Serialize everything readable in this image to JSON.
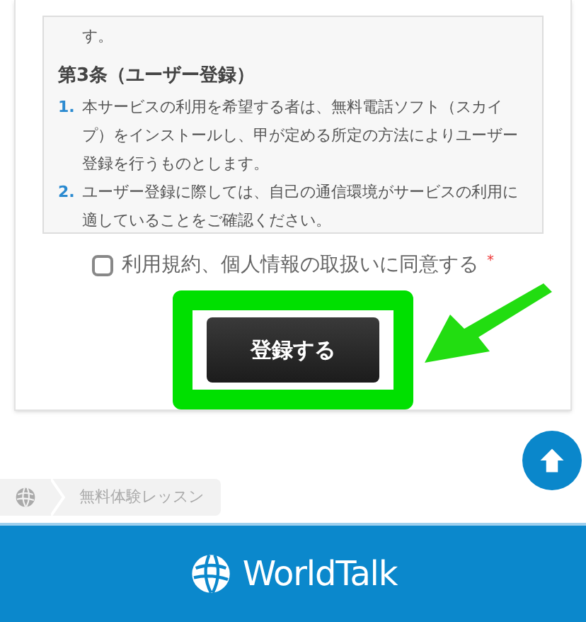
{
  "terms_box": {
    "lead_line": "す。",
    "article_heading": "第3条（ユーザー登録）",
    "items": [
      {
        "number": "1.",
        "text": "本サービスの利用を希望する者は、無料電話ソフト（スカイプ）をインストールし、甲が定める所定の方法によりユーザー登録を行うものとします。"
      },
      {
        "number": "2.",
        "text": "ユーザー登録に際しては、自己の通信環境がサービスの利用に適していることをご確認ください。"
      }
    ]
  },
  "agreement": {
    "checked": false,
    "label": "利用規約、個人情報の取扱いに同意する",
    "required_mark": "*"
  },
  "register_button": {
    "label": "登録する"
  },
  "breadcrumb": [
    {
      "label": "無料体験レッスン"
    }
  ],
  "footer": {
    "logo_text": "WorldTalk"
  }
}
